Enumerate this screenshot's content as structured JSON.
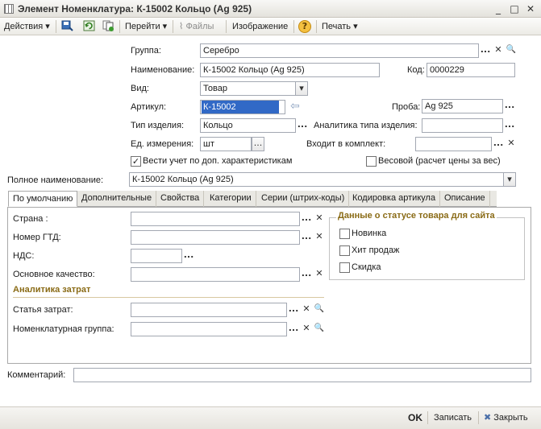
{
  "window": {
    "title": "Элемент Номенклатура: К-15002 Кольцо (Ag 925)",
    "minimize_glyph": "_",
    "maximize_glyph": "□",
    "close_glyph": "✕"
  },
  "toolbar": {
    "actions_label": "Действия",
    "goto_label": "Перейти",
    "files_label": "Файлы",
    "image_label": "Изображение",
    "help_glyph": "?",
    "print_label": "Печать",
    "dropdown_glyph": "▾"
  },
  "glyphs": {
    "ellipsis": "...",
    "clear": "✕",
    "search": "🔍",
    "check": "✓",
    "dropdown": "▾",
    "arrow_left": "⇦"
  },
  "form": {
    "group": {
      "label": "Группа:",
      "value": "Серебро"
    },
    "name": {
      "label": "Наименование:",
      "value": "К-15002 Кольцо (Ag 925)"
    },
    "code": {
      "label": "Код:",
      "value": "0000229"
    },
    "kind": {
      "label": "Вид:",
      "value": "Товар"
    },
    "article": {
      "label": "Артикул:",
      "value": "К-15002"
    },
    "assay": {
      "label": "Проба:",
      "value": "Ag 925"
    },
    "item_type": {
      "label": "Тип изделия:",
      "value": "Кольцо"
    },
    "item_type_analytics": {
      "label": "Аналитика типа изделия:",
      "value": ""
    },
    "unit": {
      "label": "Ед. измерения:",
      "value": "шт"
    },
    "kit": {
      "label": "Входит в комплект:",
      "value": ""
    },
    "track_chars": {
      "label": "Вести учет по доп. характеристикам",
      "checked": true
    },
    "weight": {
      "label": "Весовой (расчет цены за вес)",
      "checked": false
    },
    "full_name": {
      "label": "Полное наименование:",
      "value": "К-15002 Кольцо (Ag 925)"
    }
  },
  "tabs": [
    {
      "label": "По умолчанию",
      "active": true
    },
    {
      "label": "Дополнительные",
      "active": false
    },
    {
      "label": "Свойства",
      "active": false
    },
    {
      "label": "Категории",
      "active": false
    },
    {
      "label": "Серии (штрих-коды)",
      "active": false
    },
    {
      "label": "Кодировка артикула",
      "active": false
    },
    {
      "label": "Описание",
      "active": false
    }
  ],
  "default_tab": {
    "country": {
      "label": "Страна :",
      "value": ""
    },
    "gtd": {
      "label": "Номер ГТД:",
      "value": ""
    },
    "vat": {
      "label": "НДС:",
      "value": ""
    },
    "quality": {
      "label": "Основное качество:",
      "value": ""
    },
    "site_status": {
      "title": "Данные о статусе товара для сайта",
      "items": [
        {
          "label": "Новинка",
          "checked": false
        },
        {
          "label": "Хит продаж",
          "checked": false
        },
        {
          "label": "Скидка",
          "checked": false
        }
      ]
    },
    "cost_analytics": {
      "title": "Аналитика затрат",
      "cost_item": {
        "label": "Статья затрат:",
        "value": ""
      },
      "nomenclature_group": {
        "label": "Номенклатурная группа:",
        "value": ""
      }
    }
  },
  "comment": {
    "label": "Комментарий:",
    "value": ""
  },
  "bottom": {
    "ok_label": "OK",
    "save_label": "Записать",
    "close_label": "Закрыть",
    "close_glyph": "✖"
  },
  "colors": {
    "selection": "#3169c6",
    "section_title": "#8a6b16",
    "field_border": "#a3a8b2"
  }
}
